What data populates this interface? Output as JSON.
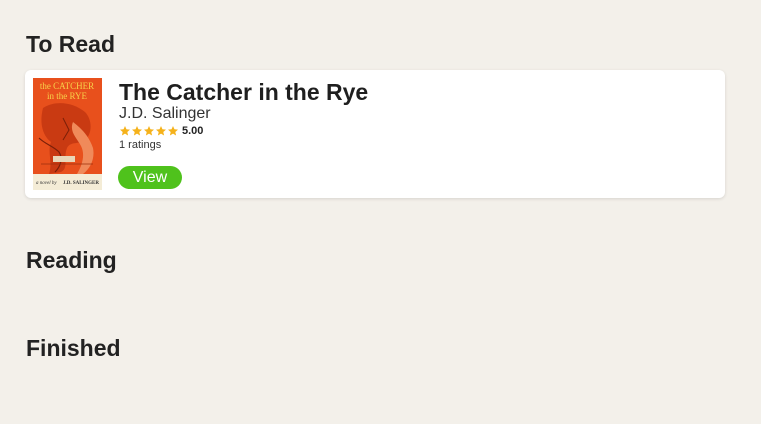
{
  "sections": [
    {
      "title": "To Read"
    },
    {
      "title": "Reading"
    },
    {
      "title": "Finished"
    }
  ],
  "to_read": {
    "books": [
      {
        "title": "The Catcher in the Rye",
        "author": "J.D. Salinger",
        "rating_value": "5.00",
        "stars": 5,
        "ratings_count": "1 ratings",
        "view_label": "View",
        "cover": {
          "title_line1": "the CATCHER",
          "title_line2": "in the RYE",
          "byline_left": "a novel by",
          "byline_right": "J.D. SALINGER"
        }
      }
    ]
  },
  "colors": {
    "background": "#f3f0ea",
    "card": "#ffffff",
    "view_button": "#4fc21c",
    "star": "#f5b21b",
    "cover_bg": "#f4ecd6",
    "cover_art": "#e8501c"
  }
}
